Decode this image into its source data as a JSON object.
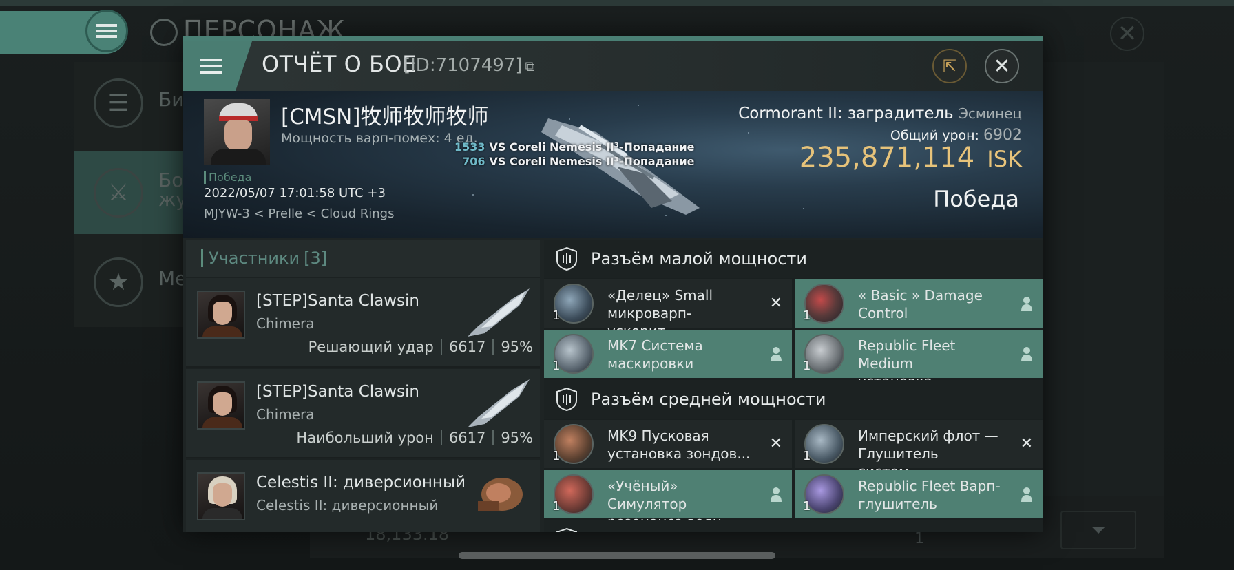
{
  "background": {
    "title": "ПЕРСОНАЖ",
    "side_items": [
      {
        "label": "Би",
        "icon": "list-icon"
      },
      {
        "label": "Бо\nжу",
        "icon": "swords-icon"
      },
      {
        "label": "Ме",
        "icon": "star-icon"
      }
    ],
    "bottom_value": "18,133.18",
    "page_number": "1"
  },
  "modal": {
    "title": "ОТЧЁТ О БОЕ",
    "report_id": "[ID:7107497]",
    "colors": {
      "accent": "#4a7d72",
      "isk": "#e7c37a",
      "hit_number": "#6fb9c8"
    }
  },
  "killer": {
    "name": "[CMSN]牧师牧师牧师",
    "warp": "Мощность варп-помех: 4 ед.",
    "result": "Победа",
    "date": "2022/05/07 17:01:58 UTC +3",
    "location": "MJYW-3 < Prelle < Cloud Rings"
  },
  "hits": [
    {
      "value": "1533",
      "text": "VS Coreli Nemesis II³-Попадание"
    },
    {
      "value": "706",
      "text": "VS Coreli Nemesis II³-Попадание"
    }
  ],
  "victim": {
    "ship": "Cormorant II: заградитель",
    "ship_class": "Эсминец",
    "damage_label": "Общий урон:",
    "damage_value": "6902",
    "isk_value": "235,871,114",
    "isk_unit": "ISK",
    "result": "Победа"
  },
  "participants": {
    "header": "Участники",
    "count": "[3]",
    "items": [
      {
        "name": "[STEP]Santa Clawsin",
        "ship": "Chimera",
        "role": "Решающий удар",
        "damage": "6617",
        "percent": "95%"
      },
      {
        "name": "[STEP]Santa Clawsin",
        "ship": "Chimera",
        "role": "Наибольший урон",
        "damage": "6617",
        "percent": "95%"
      },
      {
        "name": "Celestis II: диверсионный",
        "ship": "Celestis II: диверсионный",
        "role": "",
        "damage": "",
        "percent": ""
      }
    ]
  },
  "fitting": {
    "low_slot_title": "Разъём малой мощности",
    "mid_slot_title": "Разъём средней мощности",
    "low_modules": [
      {
        "name": "«Делец» Small микроварп-ускорит...",
        "qty": "1",
        "status": "destroyed"
      },
      {
        "name": "« Basic » Damage Control",
        "qty": "1",
        "status": "dropped"
      },
      {
        "name": "MK7 Система маскировки",
        "qty": "1",
        "status": "dropped"
      },
      {
        "name": "Republic Fleet Medium установка...",
        "qty": "1",
        "status": "dropped"
      }
    ],
    "mid_modules": [
      {
        "name": "MK9 Пусковая установка зондов...",
        "qty": "1",
        "status": "destroyed"
      },
      {
        "name": "Имперский флот — Глушитель систем...",
        "qty": "1",
        "status": "destroyed"
      },
      {
        "name": "«Учёный» Симулятор резонанса волн...",
        "qty": "1",
        "status": "dropped"
      },
      {
        "name": "Republic Fleet Варп-глушитель",
        "qty": "1",
        "status": "dropped"
      }
    ]
  }
}
